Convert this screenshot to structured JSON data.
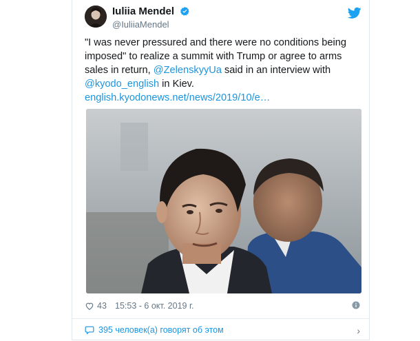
{
  "tweet": {
    "display_name": "Iuliia Mendel",
    "handle": "@IuliiaMendel",
    "text_1": "\"I was never pressured and there were no conditions being imposed\" to realize a summit with Trump or agree to arms sales in return, ",
    "mention_1": "@ZelenskyyUa",
    "text_2": " said in an interview with ",
    "mention_2": "@kyodo_english",
    "text_3": " in Kiev.",
    "link": "english.kyodonews.net/news/2019/10/e…",
    "likes": "43",
    "timestamp": "15:53 - 6 окт. 2019 г.",
    "people_talking": "395 человек(а) говорят об этом"
  },
  "icons": {
    "verified": "verified-badge-icon",
    "twitter": "twitter-bird-icon",
    "like": "heart-icon",
    "info": "info-icon",
    "reply": "speech-bubble-icon",
    "chevron": "chevron-right-icon"
  },
  "colors": {
    "link": "#1b95e0",
    "text": "#14171a",
    "muted": "#657786",
    "border": "#e1e8ed"
  }
}
